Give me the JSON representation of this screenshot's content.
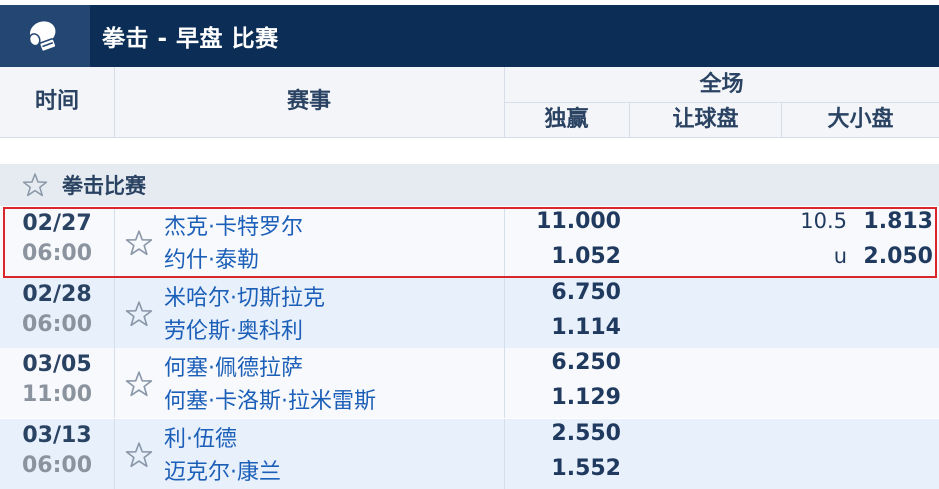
{
  "header": {
    "title": "拳击 - 早盘 比赛",
    "icon": "boxing-glove-icon"
  },
  "columns": {
    "time": "时间",
    "event": "赛事",
    "full": "全场",
    "one_x_two": "独赢",
    "handicap": "让球盘",
    "over_under": "大小盘"
  },
  "league": {
    "name": "拳击比赛"
  },
  "matches": [
    {
      "date": "02/27",
      "time": "06:00",
      "home": "杰克·卡特罗尔",
      "away": "约什·泰勒",
      "odd_home": "11.000",
      "odd_away": "1.052",
      "ou_line_top": "10.5",
      "ou_odd_top": "1.813",
      "ou_line_bot": "u",
      "ou_odd_bot": "2.050"
    },
    {
      "date": "02/28",
      "time": "06:00",
      "home": "米哈尔·切斯拉克",
      "away": "劳伦斯·奥科利",
      "odd_home": "6.750",
      "odd_away": "1.114"
    },
    {
      "date": "03/05",
      "time": "11:00",
      "home": "何塞·佩德拉萨",
      "away": "何塞·卡洛斯·拉米雷斯",
      "odd_home": "6.250",
      "odd_away": "1.129"
    },
    {
      "date": "03/13",
      "time": "06:00",
      "home": "利·伍德",
      "away": "迈克尔·康兰",
      "odd_home": "2.550",
      "odd_away": "1.552"
    }
  ],
  "colors": {
    "header_bg": "#0c2d55",
    "accent_link": "#1c5fb8",
    "highlight": "#d9262c"
  }
}
